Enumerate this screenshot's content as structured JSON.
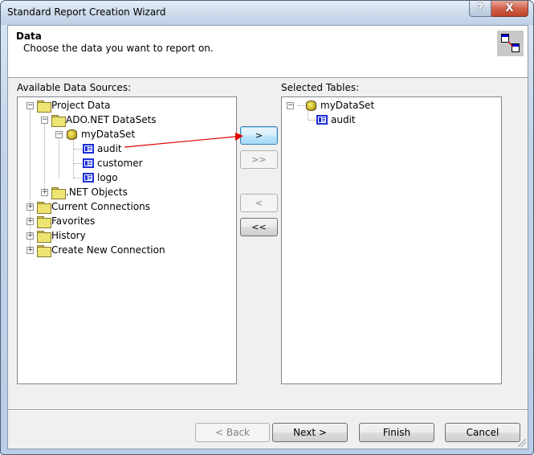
{
  "window": {
    "title": "Standard Report Creation Wizard",
    "help_label": "?",
    "close_label": "X"
  },
  "header": {
    "title": "Data",
    "subtitle": "Choose the data you want to report on."
  },
  "available": {
    "label": "Available Data Sources:",
    "tree": {
      "project_data": "Project Data",
      "ado_datasets": "ADO.NET DataSets",
      "mydataset": "myDataSet",
      "tables": [
        "audit",
        "customer",
        "logo"
      ],
      "net_objects": ".NET Objects",
      "current_connections": "Current Connections",
      "favorites": "Favorites",
      "history": "History",
      "create_new_connection": "Create New Connection"
    }
  },
  "move_buttons": {
    "add": ">",
    "add_all": ">>",
    "remove": "<",
    "remove_all": "<<"
  },
  "selected": {
    "label": "Selected Tables:",
    "tree": {
      "dataset": "myDataSet",
      "tables": [
        "audit"
      ]
    }
  },
  "footer": {
    "back": "< Back",
    "next": "Next >",
    "finish": "Finish",
    "cancel": "Cancel"
  },
  "expander": {
    "expanded": "−",
    "collapsed": "+"
  },
  "annotation_color": "#e00000"
}
